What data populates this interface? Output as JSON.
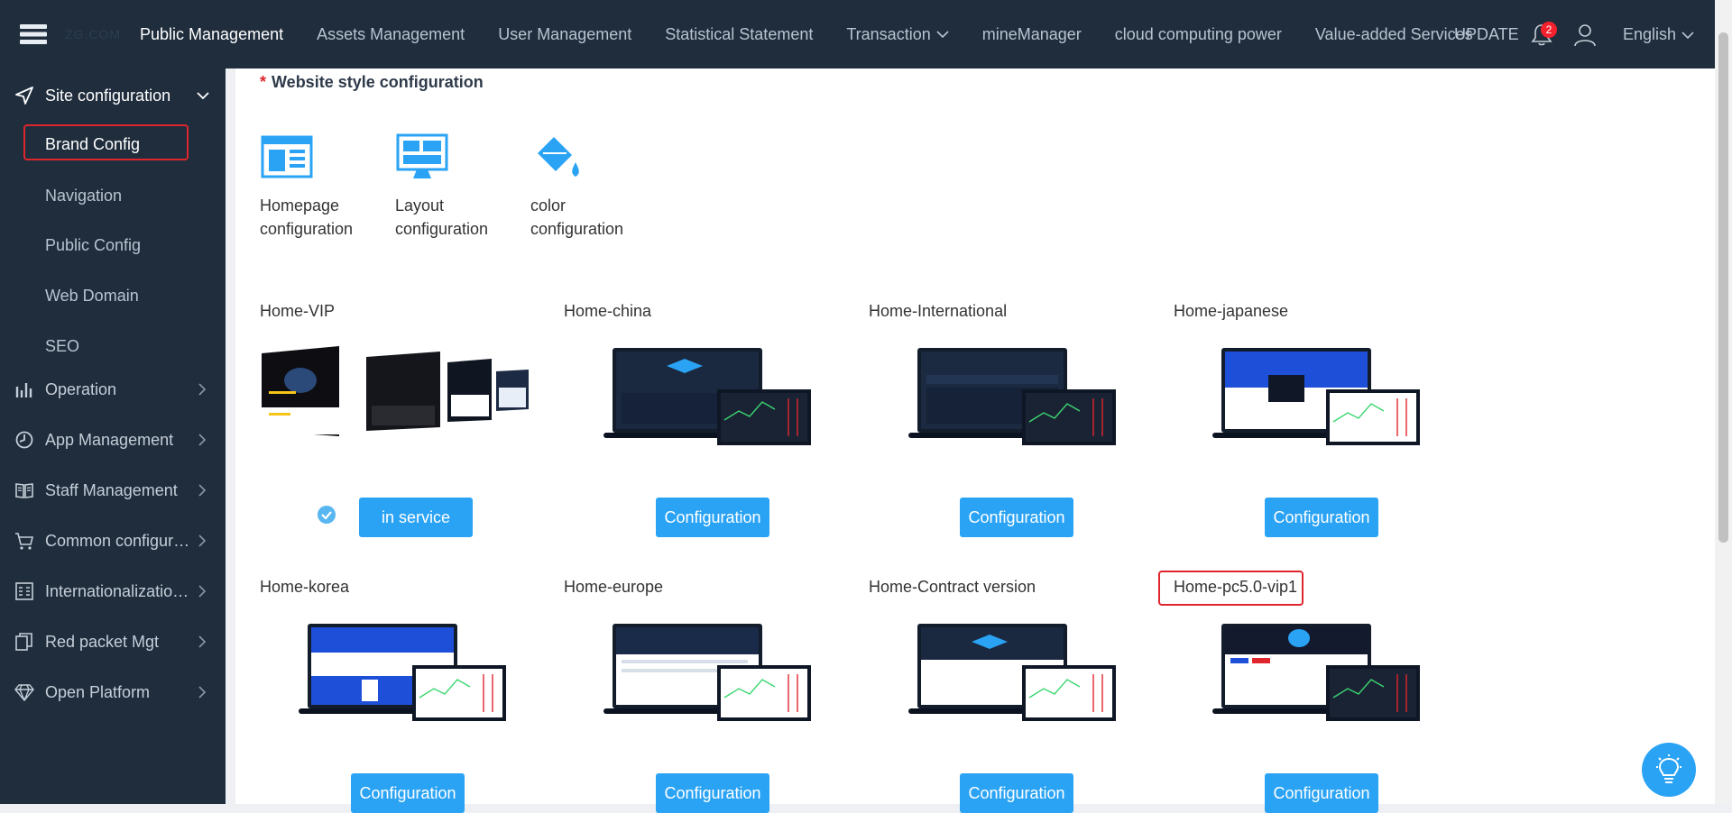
{
  "header": {
    "logo_text": "ZG.COM",
    "nav": [
      {
        "label": "Public Management",
        "active": true
      },
      {
        "label": "Assets Management"
      },
      {
        "label": "User Management"
      },
      {
        "label": "Statistical Statement"
      },
      {
        "label": "Transaction",
        "dropdown": true
      },
      {
        "label": "mineManager"
      },
      {
        "label": "cloud computing power"
      },
      {
        "label": "Value-added Services"
      }
    ],
    "update_label": "UPDATE",
    "notification_count": "2",
    "language": "English"
  },
  "sidebar": {
    "groups": [
      {
        "label": "Site configuration",
        "icon": "send-icon",
        "expanded": true
      },
      {
        "label": "Operation",
        "icon": "bar-chart-icon"
      },
      {
        "label": "App Management",
        "icon": "clock-icon"
      },
      {
        "label": "Staff Management",
        "icon": "book-icon"
      },
      {
        "label": "Common configura...",
        "icon": "cart-icon"
      },
      {
        "label": "Internationalization...",
        "icon": "grid-icon"
      },
      {
        "label": "Red packet Mgt",
        "icon": "copy-icon"
      },
      {
        "label": "Open Platform",
        "icon": "diamond-icon"
      }
    ],
    "sub_items": [
      {
        "label": "Brand Config",
        "active": true
      },
      {
        "label": "Navigation"
      },
      {
        "label": "Public Config"
      },
      {
        "label": "Web Domain"
      },
      {
        "label": "SEO"
      }
    ]
  },
  "main": {
    "section_title": "Website style configuration",
    "required_mark": "*",
    "style_options": [
      {
        "label": "Homepage configuration",
        "icon": "homepage-layout-icon"
      },
      {
        "label": "Layout configuration",
        "icon": "monitor-layout-icon"
      },
      {
        "label": "color configuration",
        "icon": "paint-bucket-icon"
      }
    ],
    "templates": [
      {
        "name": "Home-VIP",
        "button": "in service",
        "in_service": true
      },
      {
        "name": "Home-china",
        "button": "Configuration"
      },
      {
        "name": "Home-International",
        "button": "Configuration"
      },
      {
        "name": "Home-japanese",
        "button": "Configuration"
      },
      {
        "name": "Home-korea",
        "button": "Configuration"
      },
      {
        "name": "Home-europe",
        "button": "Configuration"
      },
      {
        "name": "Home-Contract version",
        "button": "Configuration"
      },
      {
        "name": "Home-pc5.0-vip1",
        "button": "Configuration"
      }
    ]
  },
  "colors": {
    "sidebar_bg": "#1f2d3d",
    "accent": "#2aa3f5",
    "highlight_box": "#e0262d"
  }
}
